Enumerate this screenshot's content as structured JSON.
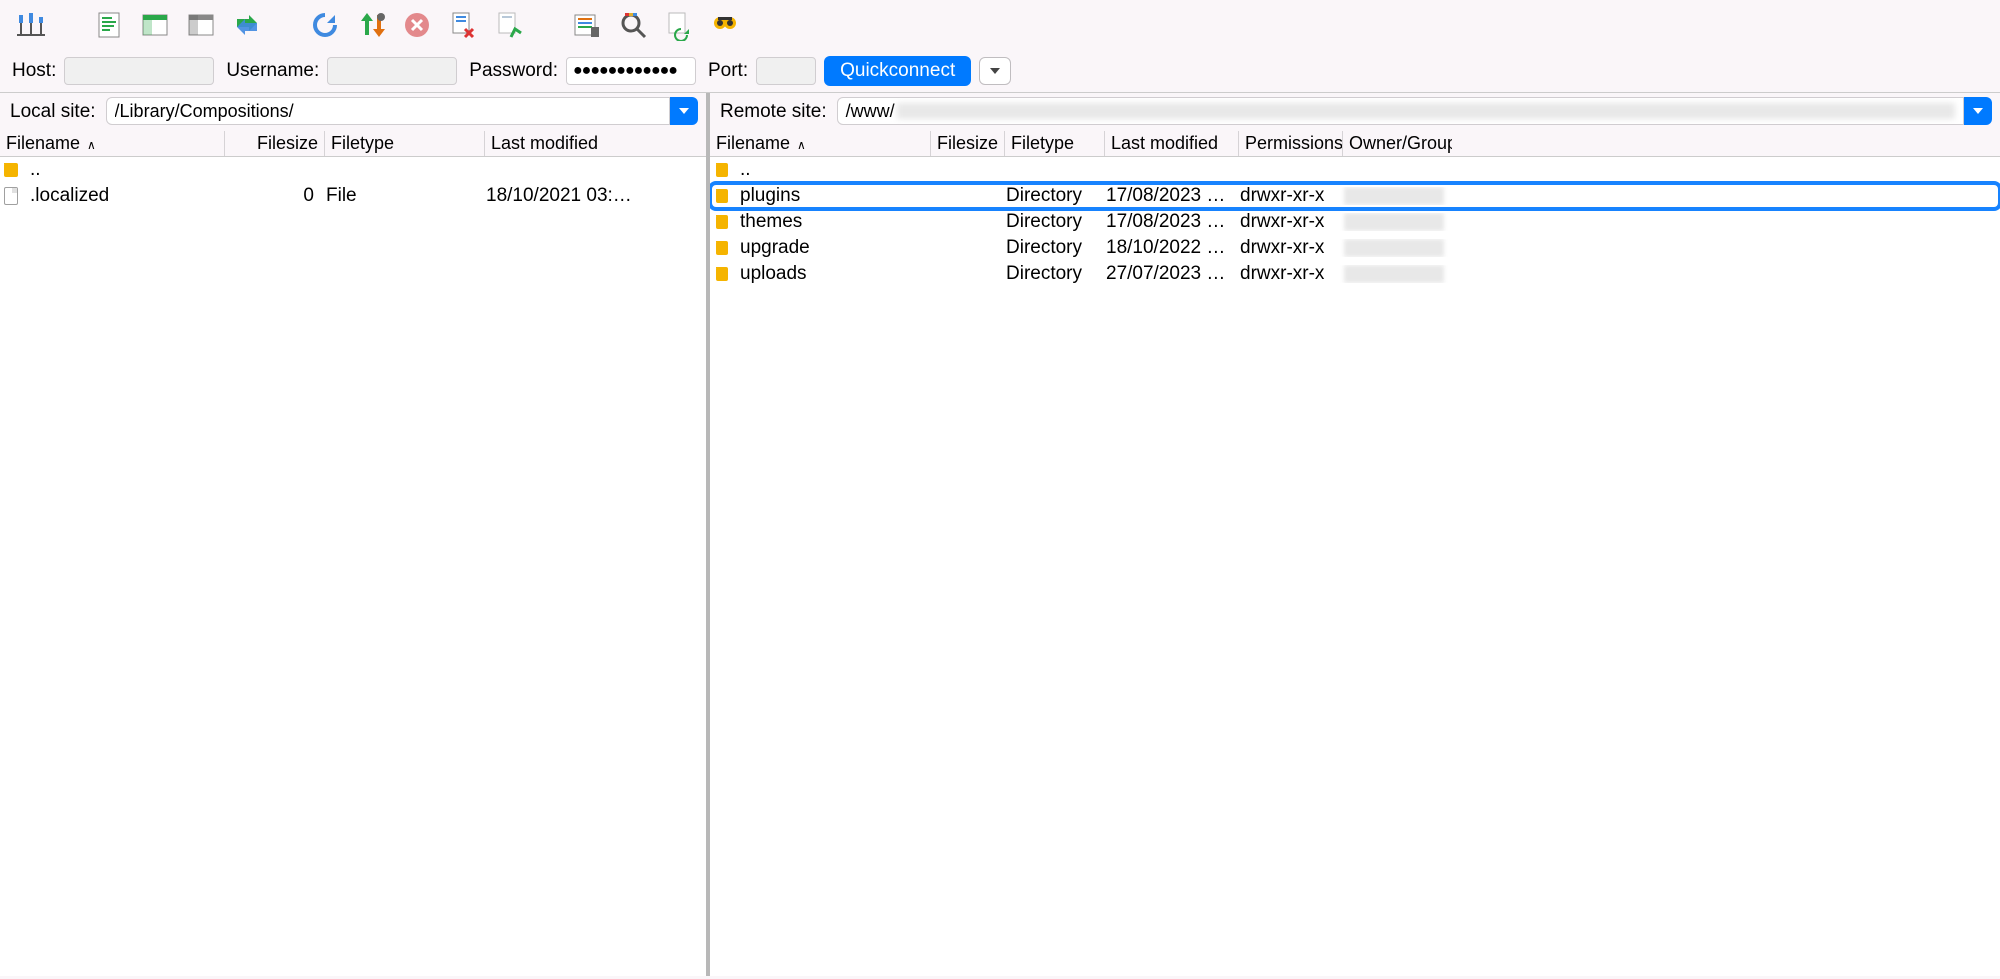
{
  "conn": {
    "host_label": "Host:",
    "username_label": "Username:",
    "password_label": "Password:",
    "port_label": "Port:",
    "password_mask": "●●●●●●●●●●●●",
    "quickconnect": "Quickconnect"
  },
  "local": {
    "label": "Local site:",
    "path": "/Library/Compositions/",
    "columns": {
      "filename": "Filename",
      "filesize": "Filesize",
      "filetype": "Filetype",
      "modified": "Last modified"
    },
    "rows": [
      {
        "icon": "folder",
        "name": "..",
        "size": "",
        "type": "",
        "modified": ""
      },
      {
        "icon": "file",
        "name": ".localized",
        "size": "0",
        "type": "File",
        "modified": "18/10/2021 03:3…"
      }
    ]
  },
  "remote": {
    "label": "Remote site:",
    "path_prefix": "/www/",
    "columns": {
      "filename": "Filename",
      "filesize": "Filesize",
      "filetype": "Filetype",
      "modified": "Last modified",
      "permissions": "Permissions",
      "owner": "Owner/Group"
    },
    "rows": [
      {
        "icon": "folder",
        "name": "..",
        "type": "",
        "modified": "",
        "permissions": "",
        "highlight": false
      },
      {
        "icon": "folder",
        "name": "plugins",
        "type": "Directory",
        "modified": "17/08/2023 0…",
        "permissions": "drwxr-xr-x",
        "highlight": true
      },
      {
        "icon": "folder",
        "name": "themes",
        "type": "Directory",
        "modified": "17/08/2023 0…",
        "permissions": "drwxr-xr-x",
        "highlight": false
      },
      {
        "icon": "folder",
        "name": "upgrade",
        "type": "Directory",
        "modified": "18/10/2022 0…",
        "permissions": "drwxr-xr-x",
        "highlight": false
      },
      {
        "icon": "folder",
        "name": "uploads",
        "type": "Directory",
        "modified": "27/07/2023 1…",
        "permissions": "drwxr-xr-x",
        "highlight": false
      }
    ]
  }
}
